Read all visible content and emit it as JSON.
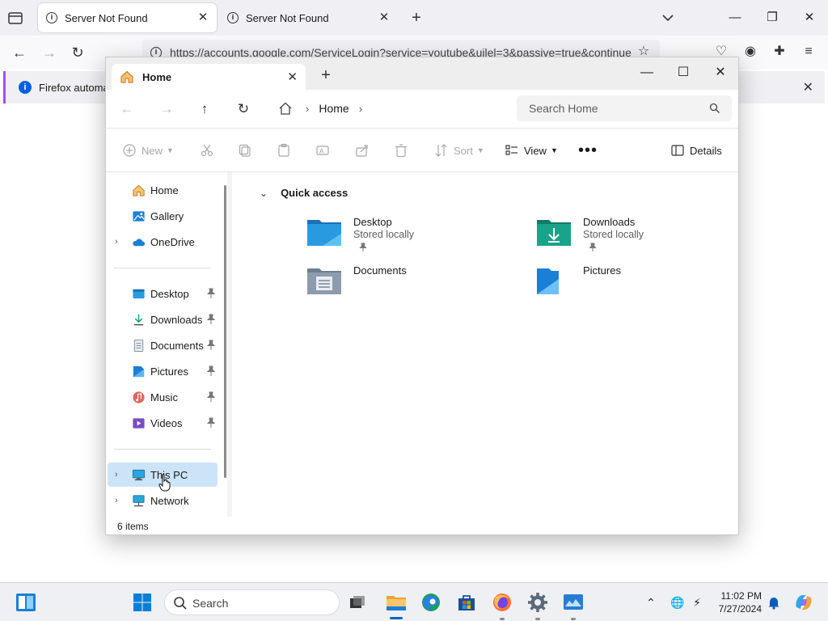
{
  "firefox": {
    "tabs": [
      {
        "title": "Server Not Found",
        "active": true
      },
      {
        "title": "Server Not Found",
        "active": false
      }
    ],
    "url": "https://accounts.google.com/ServiceLogin?service=youtube&uilel=3&passive=true&continue",
    "notice": "Firefox automatio"
  },
  "explorer": {
    "tab_title": "Home",
    "breadcrumb": [
      "Home"
    ],
    "search_placeholder": "Search Home",
    "commands": {
      "new": "New",
      "sort": "Sort",
      "view": "View",
      "details": "Details"
    },
    "nav": {
      "top": [
        {
          "label": "Home",
          "icon": "home-icon"
        },
        {
          "label": "Gallery",
          "icon": "gallery-icon"
        },
        {
          "label": "OneDrive",
          "icon": "cloud-icon"
        }
      ],
      "pinned": [
        {
          "label": "Desktop",
          "icon": "desktop-folder-icon"
        },
        {
          "label": "Downloads",
          "icon": "download-icon"
        },
        {
          "label": "Documents",
          "icon": "document-icon"
        },
        {
          "label": "Pictures",
          "icon": "pictures-icon"
        },
        {
          "label": "Music",
          "icon": "music-icon"
        },
        {
          "label": "Videos",
          "icon": "video-icon"
        }
      ],
      "bottom": [
        {
          "label": "This PC",
          "icon": "monitor-icon",
          "selected": true
        },
        {
          "label": "Network",
          "icon": "network-icon"
        }
      ]
    },
    "quick_access": {
      "title": "Quick access",
      "items": [
        {
          "name": "Desktop",
          "sub": "Stored locally",
          "pinned": true
        },
        {
          "name": "Downloads",
          "sub": "Stored locally",
          "pinned": true
        },
        {
          "name": "Documents",
          "sub": "",
          "pinned": false
        },
        {
          "name": "Pictures",
          "sub": "",
          "pinned": false
        }
      ]
    },
    "status": "6 items"
  },
  "taskbar": {
    "search_label": "Search",
    "time": "11:02 PM",
    "date": "7/27/2024"
  },
  "colors": {
    "accent": "#0067c0",
    "selection": "#cce4f7",
    "folder_blue": "#3d8fd6",
    "folder_teal": "#1aa38a"
  }
}
